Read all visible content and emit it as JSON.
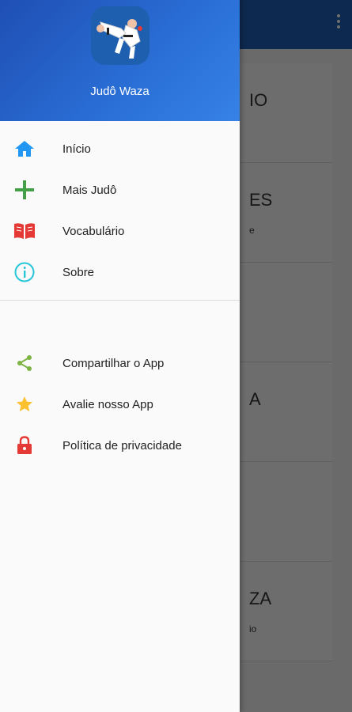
{
  "drawer": {
    "app_name": "Judô Waza",
    "primary_items": [
      {
        "label": "Início",
        "icon": "home-icon",
        "color": "#2196f3"
      },
      {
        "label": "Mais Judô",
        "icon": "plus-icon",
        "color": "#43a047"
      },
      {
        "label": "Vocabulário",
        "icon": "book-icon",
        "color": "#e53935"
      },
      {
        "label": "Sobre",
        "icon": "info-icon",
        "color": "#26c6da"
      }
    ],
    "secondary_items": [
      {
        "label": "Compartilhar o App",
        "icon": "share-icon",
        "color": "#7cb342"
      },
      {
        "label": "Avalie nosso App",
        "icon": "star-icon",
        "color": "#fbc02d"
      },
      {
        "label": "Política de privacidade",
        "icon": "lock-icon",
        "color": "#e53935"
      }
    ]
  },
  "background": {
    "cards": [
      {
        "title": "IO",
        "subtitle": ""
      },
      {
        "title": "ES",
        "subtitle": "e"
      },
      {
        "title": "",
        "subtitle": ""
      },
      {
        "title": "A",
        "subtitle": ""
      },
      {
        "title": "",
        "subtitle": ""
      },
      {
        "title": "ZA",
        "subtitle": "io"
      }
    ]
  },
  "colors": {
    "toolbar": "#1e5fb4",
    "header_gradient_start": "#1f4fb4",
    "header_gradient_end": "#3682e6"
  }
}
